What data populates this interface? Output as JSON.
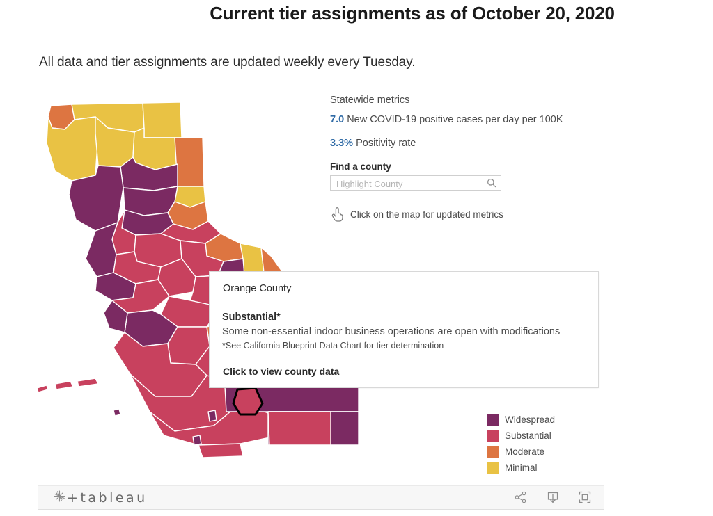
{
  "header": {
    "title": "Current tier assignments as of October 20, 2020",
    "subtitle": "All data and tier assignments are updated weekly every Tuesday."
  },
  "metrics": {
    "heading": "Statewide metrics",
    "items": [
      {
        "value": "7.0",
        "label": "New COVID-19 positive cases per day per 100K"
      },
      {
        "value": "3.3%",
        "label": "Positivity rate"
      }
    ],
    "value_color": "#2f6aa5"
  },
  "find_county": {
    "label": "Find a county",
    "input_value": "",
    "placeholder": "Highlight County",
    "search_icon": "search-icon"
  },
  "hint": {
    "icon": "pointing-hand-icon",
    "text": "Click on the map for updated metrics"
  },
  "tooltip": {
    "county": "Orange County",
    "tier": "Substantial*",
    "description": "Some non-essential indoor business operations are open with modifications",
    "footnote": "*See California Blueprint Data Chart for tier determination",
    "cta": "Click to view county data"
  },
  "legend": {
    "items": [
      {
        "label": "Widespread",
        "color": "#7B2A62"
      },
      {
        "label": "Substantial",
        "color": "#C8415E"
      },
      {
        "label": "Moderate",
        "color": "#DD7541"
      },
      {
        "label": "Minimal",
        "color": "#E9C244"
      }
    ]
  },
  "map": {
    "highlighted_county": "Orange County",
    "highlight_outline_color": "#000000",
    "border_color": "#ffffff"
  },
  "footer": {
    "brand": "tableau",
    "brand_plus": "+",
    "actions": [
      {
        "name": "share-icon",
        "label": "Share"
      },
      {
        "name": "download-icon",
        "label": "Download"
      },
      {
        "name": "fullscreen-icon",
        "label": "Full Screen"
      }
    ]
  }
}
